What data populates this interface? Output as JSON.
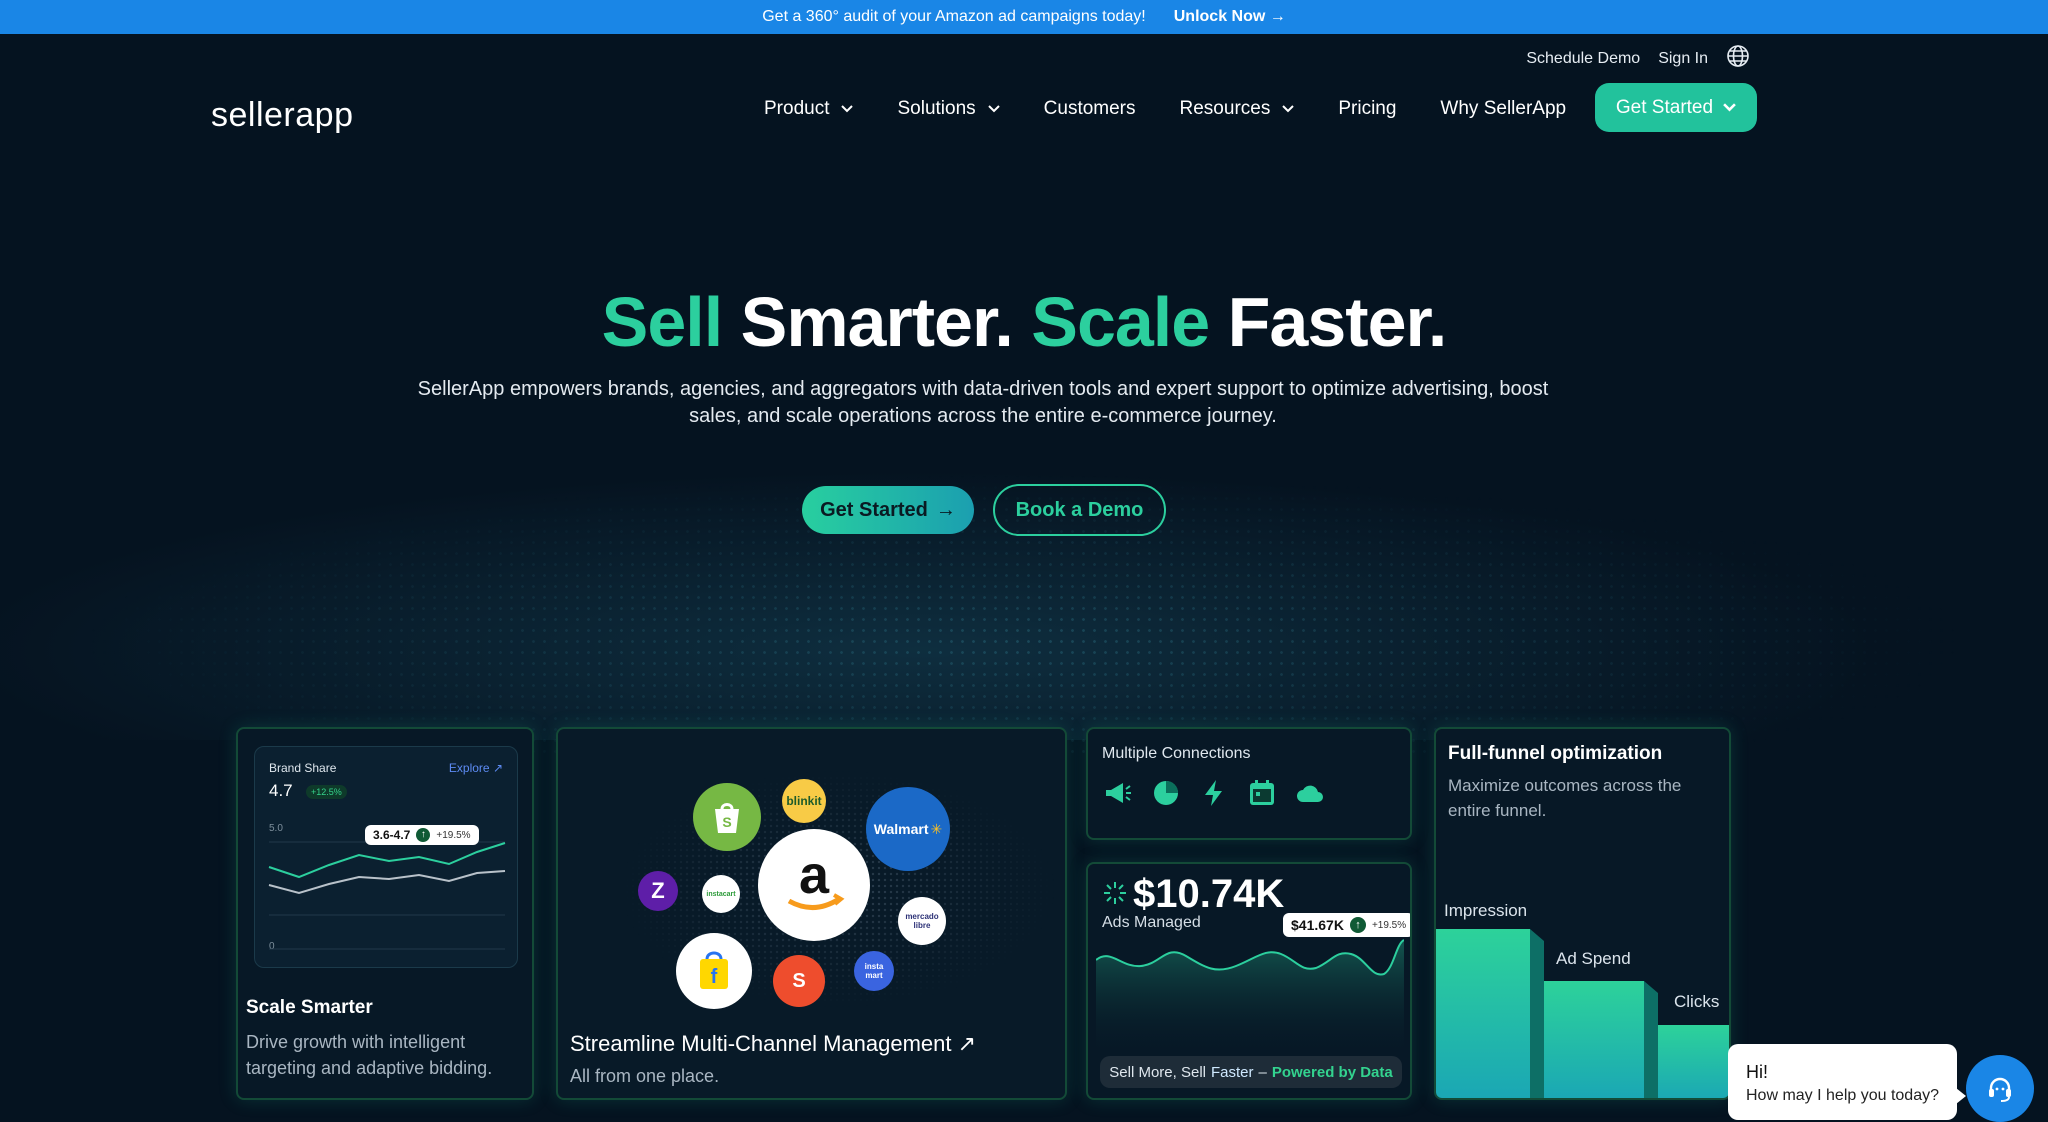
{
  "promo": {
    "text": "Get a 360° audit of your Amazon ad campaigns today!",
    "cta": "Unlock Now"
  },
  "utility": {
    "schedule_demo": "Schedule Demo",
    "sign_in": "Sign In",
    "globe_icon": "globe-icon"
  },
  "logo": "sellerapp",
  "nav": {
    "items": [
      {
        "label": "Product",
        "dropdown": true
      },
      {
        "label": "Solutions",
        "dropdown": true
      },
      {
        "label": "Customers",
        "dropdown": false
      },
      {
        "label": "Resources",
        "dropdown": true
      },
      {
        "label": "Pricing",
        "dropdown": false
      },
      {
        "label": "Why SellerApp",
        "dropdown": false
      }
    ],
    "cta": "Get Started"
  },
  "hero": {
    "headline": {
      "w1": "Sell",
      "w2": "Smarter.",
      "w3": "Scale",
      "w4": "Faster."
    },
    "subtitle": "SellerApp empowers brands, agencies, and aggregators with data-driven tools and expert support to optimize advertising, boost sales, and scale operations across the entire e-commerce journey.",
    "primary_cta": "Get Started",
    "secondary_cta": "Book a Demo"
  },
  "cards": {
    "scale": {
      "widget": {
        "label": "Brand Share",
        "value": "4.7",
        "change": "+12.5%",
        "explore": "Explore",
        "tick_top": "5.0",
        "tick_bottom": "0",
        "tooltip_range": "3.6-4.7",
        "tooltip_change": "+19.5%"
      },
      "title": "Scale Smarter",
      "desc": "Drive growth with intelligent targeting and adaptive bidding."
    },
    "multichannel": {
      "title": "Streamline Multi-Channel Management",
      "desc": "All from one place.",
      "marketplaces": [
        "shopify",
        "blinkit",
        "Walmart",
        "amazon",
        "Z",
        "instacart",
        "mercado libre",
        "flipkart",
        "Shopee",
        "insta mart"
      ]
    },
    "connections": {
      "title": "Multiple Connections",
      "icons": [
        "megaphone-icon",
        "pie-chart-icon",
        "lightning-icon",
        "calendar-icon",
        "cloud-icon"
      ]
    },
    "ads": {
      "value": "$10.74K",
      "label": "Ads Managed",
      "tooltip_value": "$41.67K",
      "tooltip_change": "+19.5%",
      "footer_prefix": "Sell More, Sell",
      "footer_faster": "Faster",
      "footer_dash": "–",
      "footer_powered": "Powered by Data"
    },
    "funnel": {
      "title": "Full-funnel optimization",
      "desc": "Maximize outcomes across the entire funnel.",
      "stages": [
        "Impression",
        "Ad Spend",
        "Clicks"
      ]
    }
  },
  "chat": {
    "greeting": "Hi!",
    "prompt": "How may I help you today?"
  },
  "colors": {
    "accent": "#2ccf9e",
    "promo_bar": "#1a86e6",
    "background": "#051320"
  }
}
